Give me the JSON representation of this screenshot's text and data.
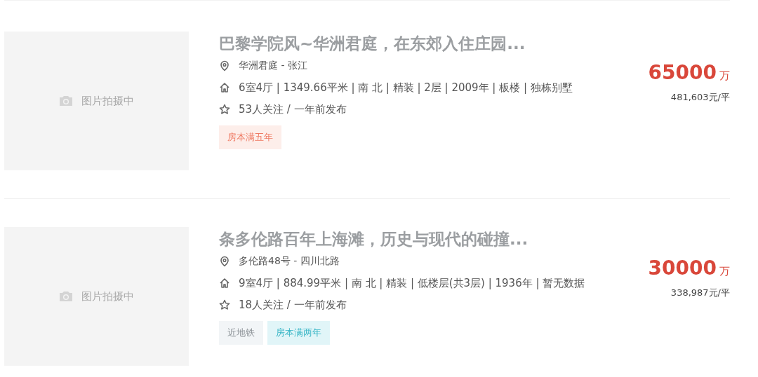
{
  "listings": [
    {
      "image": {
        "caption": "图片拍摄中"
      },
      "title": "巴黎学院风~华洲君庭，在东郊入住庄园...",
      "location": "华洲君庭 - 张江",
      "details": "6室4厅 | 1349.66平米 | 南 北 | 精装 | 2层 | 2009年 | 板楼 | 独栋别墅",
      "follow": "53人关注 / 一年前发布",
      "price": "65000",
      "price_unit": "万",
      "unit_price": "481,603元/平",
      "tags": [
        {
          "label": "房本满五年",
          "kind": "red"
        }
      ]
    },
    {
      "image": {
        "caption": "图片拍摄中"
      },
      "title": "条多伦路百年上海滩，历史与现代的碰撞...",
      "location": "多伦路48号 - 四川北路",
      "details": "9室4厅 | 884.99平米 | 南 北 | 精装 | 低楼层(共3层) | 1936年 | 暂无数据",
      "follow": "18人关注 / 一年前发布",
      "price": "30000",
      "price_unit": "万",
      "unit_price": "338,987元/平",
      "tags": [
        {
          "label": "近地铁",
          "kind": "gray"
        },
        {
          "label": "房本满两年",
          "kind": "teal"
        }
      ]
    }
  ]
}
